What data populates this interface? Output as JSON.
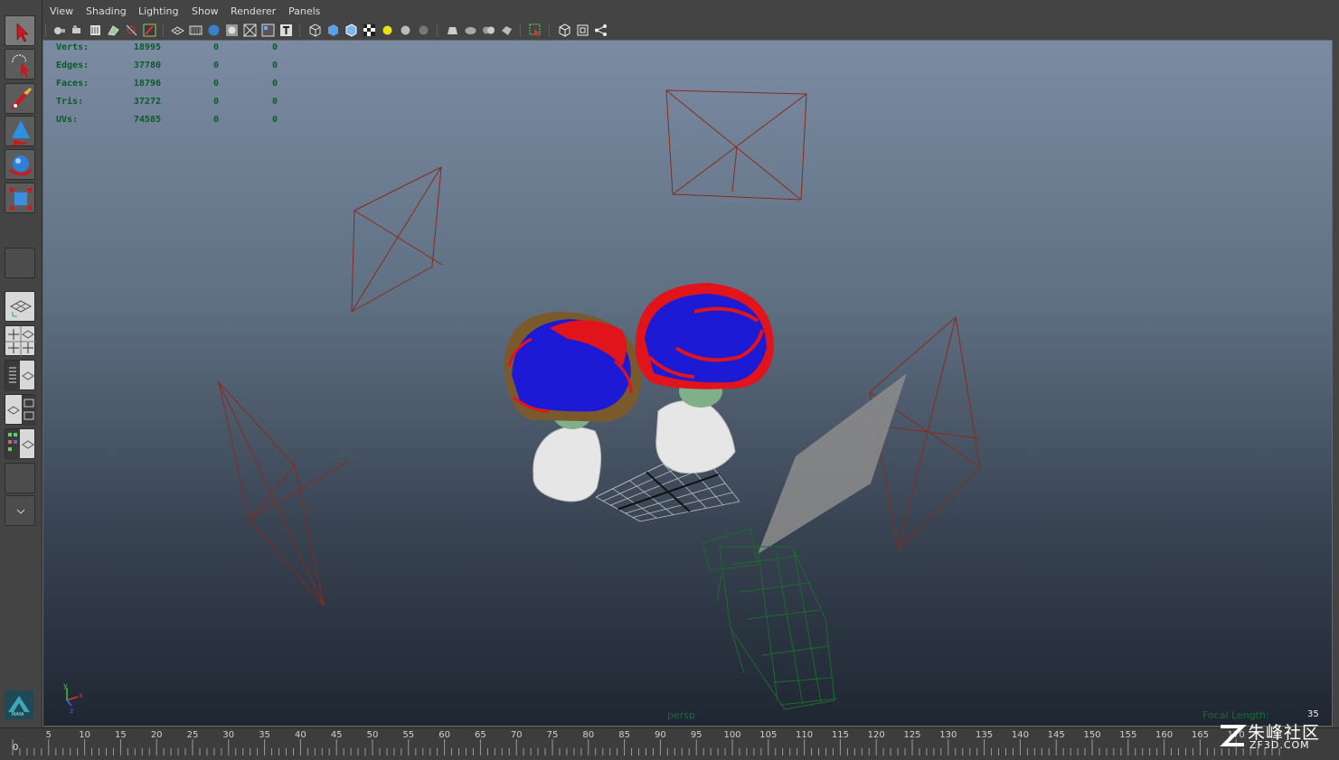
{
  "menu": [
    "View",
    "Shading",
    "Lighting",
    "Show",
    "Renderer",
    "Panels"
  ],
  "hud": {
    "rows": [
      {
        "label": "Verts:",
        "v1": "18995",
        "v2": "0",
        "v3": "0"
      },
      {
        "label": "Edges:",
        "v1": "37780",
        "v2": "0",
        "v3": "0"
      },
      {
        "label": "Faces:",
        "v1": "18796",
        "v2": "0",
        "v3": "0"
      },
      {
        "label": "Tris:",
        "v1": "37272",
        "v2": "0",
        "v3": "0"
      },
      {
        "label": "UVs:",
        "v1": "74585",
        "v2": "0",
        "v3": "0"
      }
    ]
  },
  "viewport": {
    "camera_label": "persp",
    "focal_label": "Focal Length:",
    "focal_value": "35"
  },
  "timeline": {
    "current_frame": "0",
    "ticks": [
      "5",
      "10",
      "15",
      "20",
      "25",
      "30",
      "35",
      "40",
      "45",
      "50",
      "55",
      "60",
      "65",
      "70",
      "75",
      "80",
      "85",
      "90",
      "95",
      "100",
      "105",
      "110",
      "115",
      "120",
      "125",
      "130",
      "135",
      "140",
      "145",
      "150",
      "155",
      "160",
      "165",
      "170"
    ]
  },
  "axis": {
    "x": "x",
    "y": "y",
    "z": "z"
  },
  "watermark": {
    "title": "朱峰社区",
    "sub": "ZF3D.COM"
  },
  "logo": {
    "text": "MAYA"
  },
  "colors": {
    "hud_text": "#0a5a2a",
    "hair_red": "#e0141a",
    "hair_blue": "#1d1ad6",
    "camera_lines": "#8a2a1a",
    "camera_wire_green": "#1c6b2c"
  }
}
